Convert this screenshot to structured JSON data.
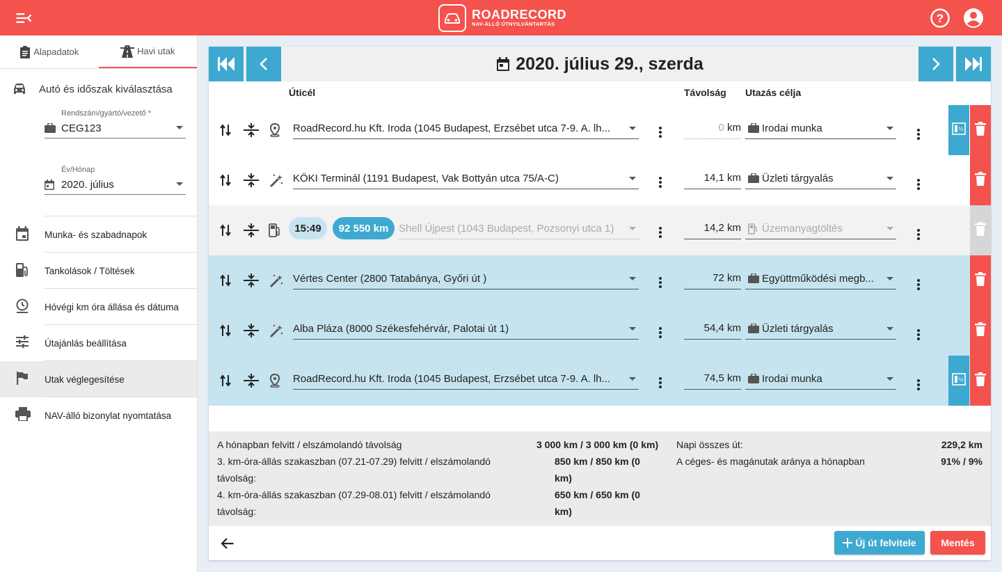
{
  "header": {
    "logo_title": "ROADRECORD",
    "logo_subtitle": "NAV-ÁLLÓ ÚTNYILVÁNTARTÁS"
  },
  "sidebar": {
    "tabs": [
      {
        "label": "Alapadatok",
        "icon": "clipboard-icon",
        "active": false
      },
      {
        "label": "Havi utak",
        "icon": "road-icon",
        "active": true
      }
    ],
    "section_title": "Autó és időszak kiválasztása",
    "vehicle_field": {
      "label": "Rendszám/gyártó/vezető *",
      "value": "CEG123"
    },
    "period_field": {
      "label": "Év/Hónap",
      "value": "2020. július"
    },
    "items": [
      {
        "label": "Munka- és szabadnapok",
        "icon": "calendar-icon"
      },
      {
        "label": "Tankolások / Töltések",
        "icon": "fuel-pump-icon"
      },
      {
        "label": "Hóvégi km óra állása és dátuma",
        "icon": "clock-icon"
      },
      {
        "label": "Útajánlás beállítása",
        "icon": "tune-icon"
      },
      {
        "label": "Utak véglegesítése",
        "icon": "flag-icon",
        "selected": true
      },
      {
        "label": "NAV-álló bizonylat nyomtatása",
        "icon": "printer-icon"
      }
    ]
  },
  "main": {
    "date_title": "2020. július 29., szerda",
    "columns": {
      "destination": "Úticél",
      "distance": "Távolság",
      "purpose": "Utazás célja"
    },
    "trips": [
      {
        "destination": "RoadRecord.hu Kft. Iroda (1045 Budapest, Erzsébet utca 7-9. A. lh...",
        "distance": "0",
        "unit": "km",
        "purpose": "Irodai munka",
        "type_icon": "location-pin-icon",
        "row_style": "white",
        "has_odometer": true,
        "delete_active": true
      },
      {
        "destination": "KÖKI Terminál (1191 Budapest, Vak Bottyán utca 75/A-C)",
        "distance": "14,1",
        "unit": "km",
        "purpose": "Üzleti tárgyalás",
        "type_icon": "magic-wand-icon",
        "row_style": "white",
        "has_odometer": false,
        "delete_active": true
      },
      {
        "destination": "Shell Újpest (1043 Budapest, Pozsonyi utca 1)",
        "distance": "14,2",
        "unit": "km",
        "purpose": "Üzemanyagtöltés",
        "type_icon": "fuel-pump-icon",
        "row_style": "grey",
        "has_odometer": false,
        "delete_active": false,
        "time_chip": "15:49",
        "odometer_chip": "92 550 km"
      },
      {
        "destination": "Vértes Center (2800 Tatabánya, Győri út )",
        "distance": "72",
        "unit": "km",
        "purpose": "Együttműködési megb...",
        "type_icon": "magic-wand-icon",
        "row_style": "blue",
        "has_odometer": false,
        "delete_active": true
      },
      {
        "destination": "Alba Pláza (8000 Székesfehérvár, Palotai út 1)",
        "distance": "54,4",
        "unit": "km",
        "purpose": "Üzleti tárgyalás",
        "type_icon": "magic-wand-icon",
        "row_style": "blue",
        "has_odometer": false,
        "delete_active": true
      },
      {
        "destination": "RoadRecord.hu Kft. Iroda (1045 Budapest, Erzsébet utca 7-9. A. lh...",
        "distance": "74,5",
        "unit": "km",
        "purpose": "Irodai munka",
        "type_icon": "location-pin-icon",
        "row_style": "blue",
        "has_odometer": true,
        "delete_active": true
      }
    ],
    "summary": {
      "left": [
        {
          "label": "A hónapban felvitt / elszámolandó távolság",
          "value": "3 000 km / 3 000 km (0 km)"
        },
        {
          "label_line1": "3. km-óra-állás szakaszban (07.21-07.29) felvitt / elszámolandó",
          "label_line2": "távolság:",
          "value_line1": "850 km / 850 km (0",
          "value_line2": "km)"
        },
        {
          "label_line1": "4. km-óra-állás szakaszban (07.29-08.01) felvitt / elszámolandó",
          "label_line2": "távolság:",
          "value_line1": "650 km / 650 km (0",
          "value_line2": "km)"
        }
      ],
      "right": [
        {
          "label": "Napi összes út:",
          "value": "229,2 km"
        },
        {
          "label": "A céges- és magánutak aránya a hónapban",
          "value": "91% / 9%"
        }
      ]
    },
    "buttons": {
      "new_trip": "Új út felvitele",
      "save": "Mentés"
    }
  },
  "colors": {
    "brand_red": "#f4524d",
    "accent_blue": "#3ea9d0",
    "row_blue": "#c6e4ef",
    "save_red": "#f4524d"
  }
}
